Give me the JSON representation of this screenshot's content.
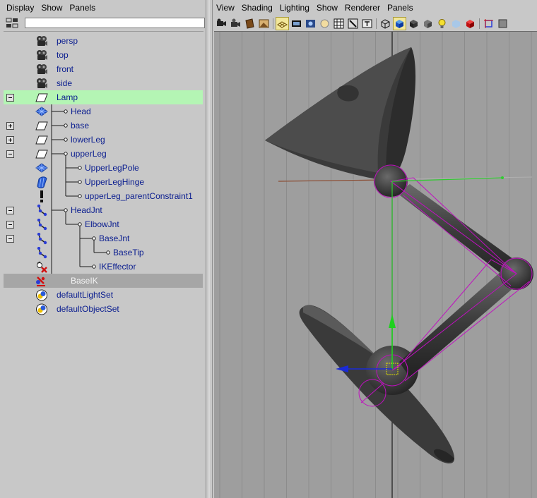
{
  "outliner": {
    "menus": [
      "Display",
      "Show",
      "Panels"
    ],
    "filter": {
      "value": "",
      "placeholder": ""
    },
    "items": [
      {
        "name": "persp",
        "icon": "camera-icon",
        "depth": 0,
        "expander": "",
        "state": ""
      },
      {
        "name": "top",
        "icon": "camera-icon",
        "depth": 0,
        "expander": "",
        "state": ""
      },
      {
        "name": "front",
        "icon": "camera-icon",
        "depth": 0,
        "expander": "",
        "state": ""
      },
      {
        "name": "side",
        "icon": "camera-icon",
        "depth": 0,
        "expander": "",
        "state": ""
      },
      {
        "name": "Lamp",
        "icon": "transform-icon",
        "depth": 0,
        "expander": "minus",
        "state": "selected-green"
      },
      {
        "name": "Head",
        "icon": "nurbs-surface-icon",
        "depth": 1,
        "expander": "",
        "state": ""
      },
      {
        "name": "base",
        "icon": "transform-icon",
        "depth": 1,
        "expander": "plus",
        "state": ""
      },
      {
        "name": "lowerLeg",
        "icon": "transform-icon",
        "depth": 1,
        "expander": "plus",
        "state": ""
      },
      {
        "name": "upperLeg",
        "icon": "transform-icon",
        "depth": 1,
        "expander": "minus",
        "state": ""
      },
      {
        "name": "UpperLegPole",
        "icon": "nurbs-surface-icon",
        "depth": 2,
        "expander": "",
        "state": ""
      },
      {
        "name": "UpperLegHinge",
        "icon": "nurbs-cylinder-icon",
        "depth": 2,
        "expander": "",
        "state": ""
      },
      {
        "name": "upperLeg_parentConstraint1",
        "icon": "constraint-icon",
        "depth": 2,
        "expander": "",
        "state": ""
      },
      {
        "name": "HeadJnt",
        "icon": "joint-icon",
        "depth": 1,
        "expander": "minus",
        "state": ""
      },
      {
        "name": "ElbowJnt",
        "icon": "joint-icon",
        "depth": 2,
        "expander": "minus",
        "state": ""
      },
      {
        "name": "BaseJnt",
        "icon": "joint-icon",
        "depth": 3,
        "expander": "minus",
        "state": ""
      },
      {
        "name": "BaseTip",
        "icon": "joint-icon",
        "depth": 4,
        "expander": "",
        "state": ""
      },
      {
        "name": "IKEffector",
        "icon": "ik-effector-icon",
        "depth": 3,
        "expander": "",
        "state": ""
      },
      {
        "name": "BaseIK",
        "icon": "ik-handle-icon",
        "depth": 1,
        "expander": "",
        "state": "selected-gray"
      },
      {
        "name": "defaultLightSet",
        "icon": "set-icon",
        "depth": 0,
        "expander": "",
        "state": ""
      },
      {
        "name": "defaultObjectSet",
        "icon": "set-icon",
        "depth": 0,
        "expander": "",
        "state": ""
      }
    ]
  },
  "viewport": {
    "menus": [
      "View",
      "Shading",
      "Lighting",
      "Show",
      "Renderer",
      "Panels"
    ],
    "toolbar": [
      "select-camera-icon",
      "camera-attributes-icon",
      "bookmark-icon",
      "image-plane-icon",
      "sep",
      "grid-icon",
      "film-gate-icon",
      "resolution-gate-icon",
      "gate-mask-icon",
      "field-chart-icon",
      "safe-action-icon",
      "safe-title-icon",
      "sep",
      "wireframe-icon",
      "smooth-shade-icon",
      "wireframe-on-shaded-icon",
      "xray-icon",
      "use-default-light-icon",
      "textured-icon",
      "shadows-icon",
      "sep",
      "isolate-select-icon",
      "xray-joints-icon"
    ],
    "toolbar_active": [
      "grid-icon",
      "smooth-shade-icon"
    ],
    "background_color": "#9e9e9e",
    "grid_color": "#8a8a8a",
    "model_color": "#3c3c3c",
    "selection_color": "#c010c0"
  }
}
